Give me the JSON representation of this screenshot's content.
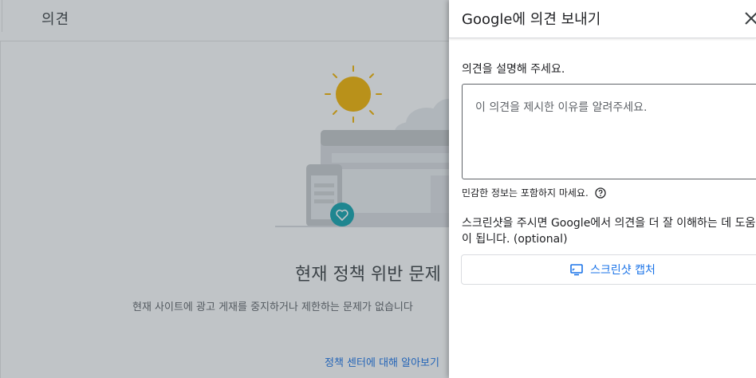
{
  "background": {
    "page_title": "의견",
    "heading": "현재 정책 위반 문제",
    "description": "현재 사이트에 광고 게재를 중지하거나 제한하는 문제가 없습니다",
    "link": "정책 센터에 대해 알아보기",
    "colors": {
      "sun": "#f5b400",
      "badge": "#12a4af",
      "link": "#1a73e8"
    }
  },
  "panel": {
    "title": "Google에 의견 보내기",
    "close_icon": "close-icon",
    "field_label": "의견을 설명해 주세요.",
    "textarea_placeholder": "이 의견을 제시한 이유를 알려주세요.",
    "hint": "민감한 정보는 포함하지 마세요.",
    "help_icon": "help-circle-icon",
    "screenshot_desc": "스크린샷을 주시면 Google에서 의견을 더 잘 이해하는 데 도움이 됩니다. (optional)",
    "capture_button": "스크린샷 캡처",
    "capture_icon": "monitor-icon",
    "colors": {
      "accent": "#1a73e8",
      "text": "#202124"
    }
  }
}
